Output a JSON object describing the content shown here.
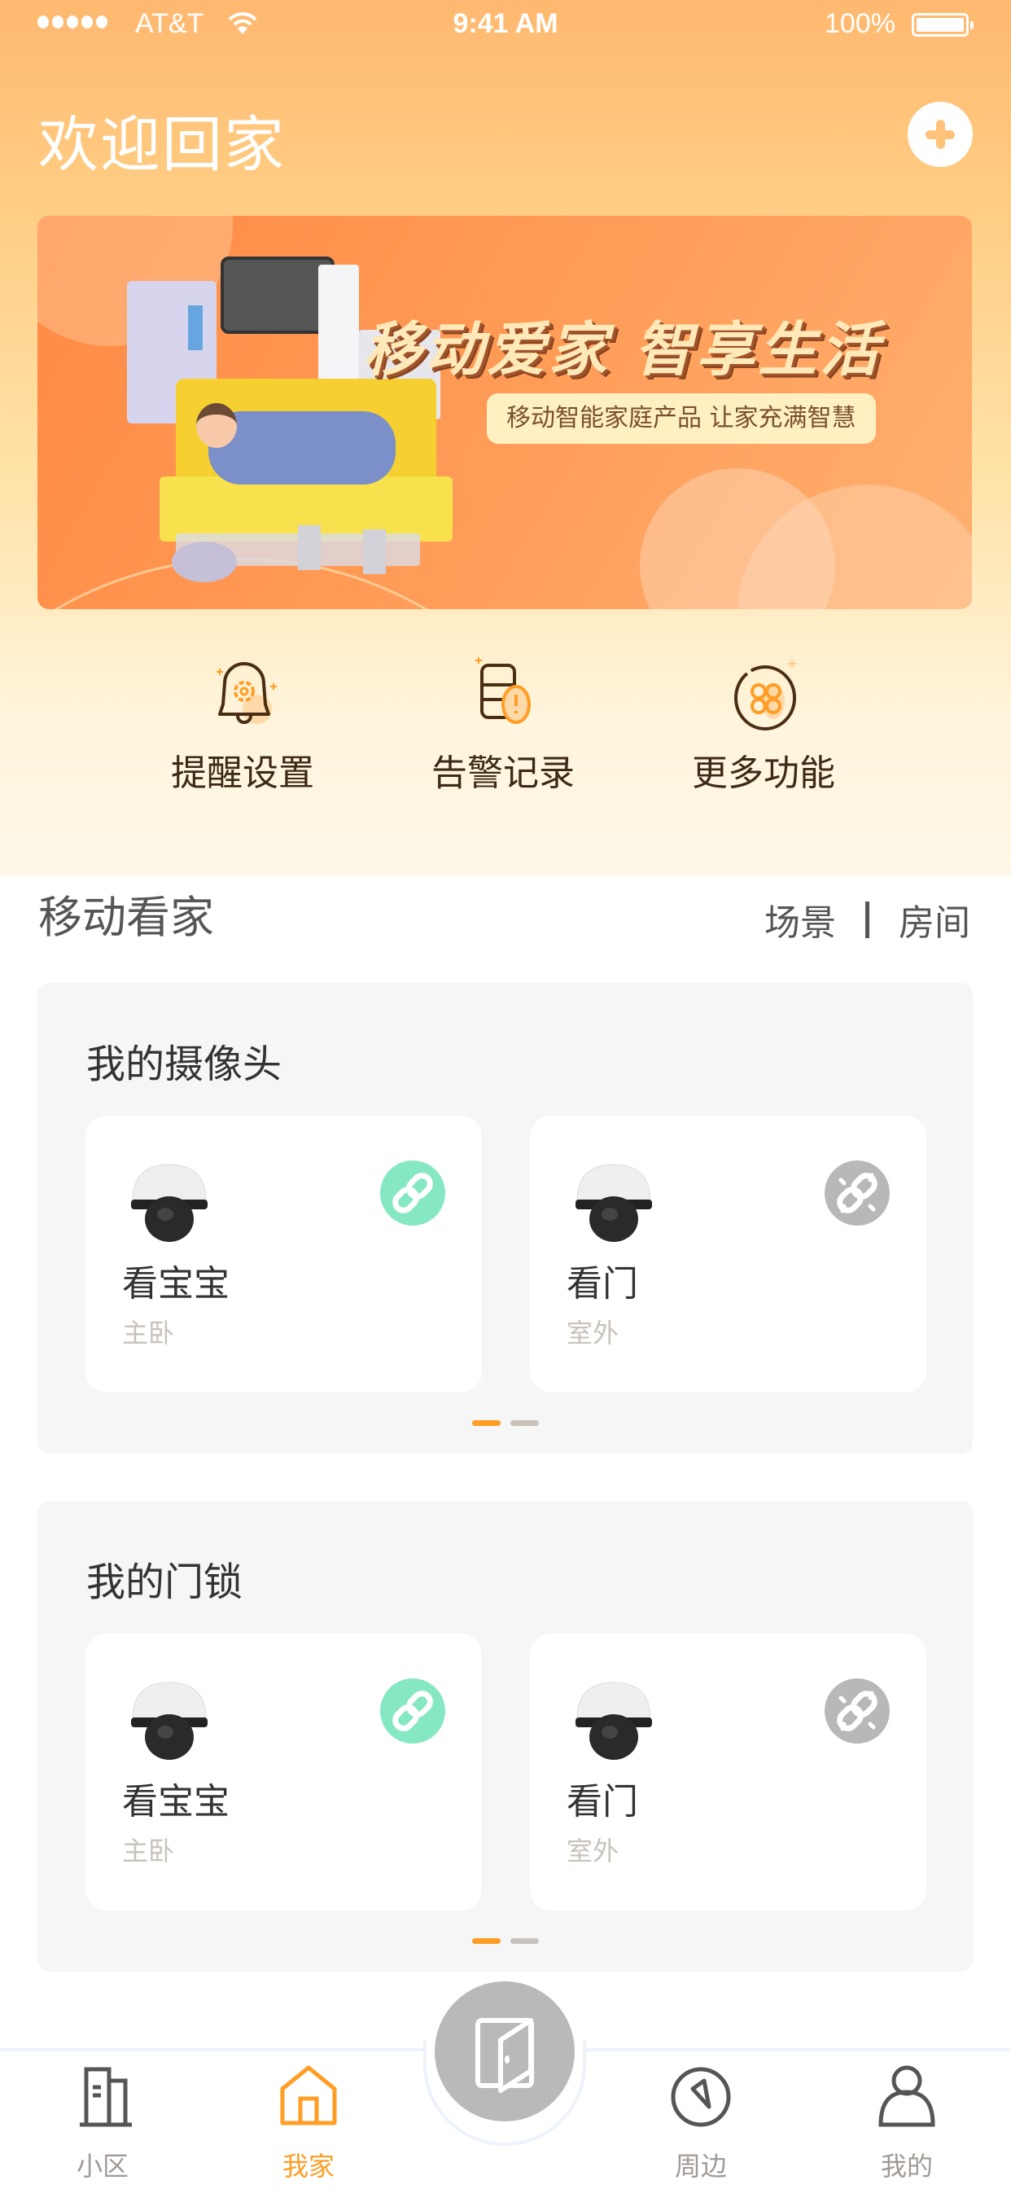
{
  "status_bar": {
    "carrier": "AT&T",
    "time": "9:41 AM",
    "battery": "100%",
    "signal_bars": 5
  },
  "header": {
    "title": "欢迎回家",
    "add_icon": "plus-circle-icon"
  },
  "banner": {
    "headline": "移动爱家  智享生活",
    "subtitle": "移动智能家庭产品  让家充满智慧"
  },
  "quick_actions": [
    {
      "label": "提醒设置",
      "icon": "bell-gear-icon"
    },
    {
      "label": "告警记录",
      "icon": "alert-record-icon"
    },
    {
      "label": "更多功能",
      "icon": "more-apps-icon"
    }
  ],
  "section": {
    "title": "移动看家",
    "tabs": [
      "场景",
      "房间"
    ]
  },
  "device_groups": [
    {
      "title": "我的摄像头",
      "devices": [
        {
          "name": "看宝宝",
          "room": "主卧",
          "status": "connected"
        },
        {
          "name": "看门",
          "room": "室外",
          "status": "disconnected"
        }
      ],
      "page_count": 2,
      "active_page": 1
    },
    {
      "title": "我的门锁",
      "devices": [
        {
          "name": "看宝宝",
          "room": "主卧",
          "status": "connected"
        },
        {
          "name": "看门",
          "room": "室外",
          "status": "disconnected"
        }
      ],
      "page_count": 2,
      "active_page": 1
    }
  ],
  "bottom_nav": {
    "items": [
      {
        "label": "小区",
        "icon": "building-icon",
        "active": false
      },
      {
        "label": "我家",
        "icon": "home-icon",
        "active": true
      },
      {
        "label": "周边",
        "icon": "compass-icon",
        "active": false
      },
      {
        "label": "我的",
        "icon": "user-icon",
        "active": false
      }
    ],
    "center_icon": "door-icon"
  },
  "colors": {
    "accent": "#ff9d24",
    "connected": "#86e8c3",
    "disconnected": "#b8b8b8",
    "header_gradient_top": "#ffb870"
  }
}
